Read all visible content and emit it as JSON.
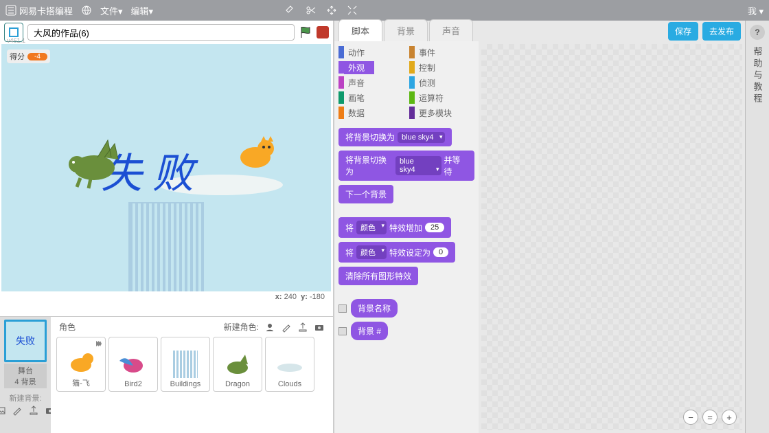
{
  "topbar": {
    "brand": "网易卡搭编程",
    "menuFile": "文件▾",
    "menuEdit": "编辑▾",
    "userMenu": "我 ▾"
  },
  "header": {
    "title": "大风的作品(6)",
    "version": "v461.1"
  },
  "stage": {
    "score_label": "得分",
    "score_value": "-4",
    "bigtext": "失 败",
    "coords_x_label": "x:",
    "coords_x": "240",
    "coords_y_label": "y:",
    "coords_y": "-180"
  },
  "stagepanel": {
    "thumb_text": "失败",
    "label1": "舞台",
    "label2": "4 背景",
    "newbg": "新建背景:"
  },
  "sprites": {
    "header": "角色",
    "newLabel": "新建角色:",
    "items": [
      "猫-飞",
      "Bird2",
      "Buildings",
      "Dragon",
      "Clouds"
    ]
  },
  "tabs": {
    "t1": "脚本",
    "t2": "背景",
    "t3": "声音"
  },
  "buttons": {
    "save": "保存",
    "publish": "去发布"
  },
  "categories": {
    "motion": "动作",
    "events": "事件",
    "looks": "外观",
    "control": "控制",
    "sound": "声音",
    "sensing": "侦测",
    "pen": "画笔",
    "operators": "运算符",
    "data": "数据",
    "more": "更多模块"
  },
  "blocks": {
    "b1_pre": "将背景切换为",
    "b1_dd": "blue sky4",
    "b2_pre": "将背景切换为",
    "b2_dd": "blue sky4",
    "b2_post": "并等待",
    "b3": "下一个背景",
    "b4_pre": "将",
    "b4_dd": "颜色",
    "b4_mid": "特效增加",
    "b4_num": "25",
    "b5_pre": "将",
    "b5_dd": "颜色",
    "b5_mid": "特效设定为",
    "b5_num": "0",
    "b6": "清除所有图形特效",
    "r1": "背景名称",
    "r2": "背景 #"
  },
  "help": {
    "q": "?",
    "text": "帮助与教程"
  }
}
